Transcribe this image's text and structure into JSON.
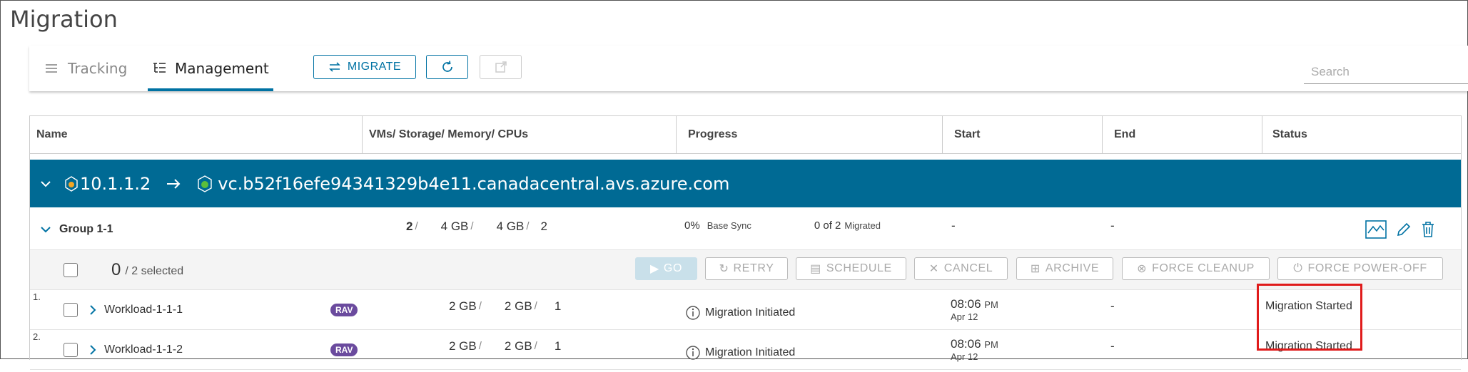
{
  "page": {
    "title": "Migration"
  },
  "tabs": [
    {
      "label": "Tracking",
      "icon": "list-icon",
      "active": false
    },
    {
      "label": "Management",
      "icon": "tree-list-icon",
      "active": true
    }
  ],
  "toolbar": {
    "migrate_label": "MIGRATE",
    "migrate_icon": "swap-arrows-icon",
    "refresh_icon": "refresh-icon",
    "export_icon": "external-link-icon"
  },
  "search": {
    "placeholder": "Search"
  },
  "table": {
    "columns": [
      "Name",
      "VMs/ Storage/ Memory/ CPUs",
      "Progress",
      "Start",
      "End",
      "Status"
    ],
    "site": {
      "source": "10.1.1.2",
      "target": "vc.b52f16efe94341329b4e11.canadacentral.avs.azure.com"
    },
    "group": {
      "name": "Group 1-1",
      "vms": "2",
      "storage": "4 GB",
      "memory": "4 GB",
      "cpus": "2",
      "progress_pct": "0%",
      "progress_label": "Base Sync",
      "migrated_count": "0 of 2",
      "migrated_label": "Migrated",
      "start": "-",
      "end": "-"
    },
    "selection": {
      "count": "0",
      "total": "/ 2 selected"
    },
    "actions": [
      "GO",
      "RETRY",
      "SCHEDULE",
      "CANCEL",
      "ARCHIVE",
      "FORCE CLEANUP",
      "FORCE POWER-OFF"
    ],
    "rows": [
      {
        "index": "1.",
        "name": "Workload-1-1-1",
        "badge": "RAV",
        "storage": "2 GB",
        "memory": "2 GB",
        "cpus": "1",
        "progress": "Migration Initiated",
        "start_time": "08:06",
        "start_ampm": "PM",
        "start_date": "Apr 12",
        "end": "-",
        "status": "Migration Started"
      },
      {
        "index": "2.",
        "name": "Workload-1-1-2",
        "badge": "RAV",
        "storage": "2 GB",
        "memory": "2 GB",
        "cpus": "1",
        "progress": "Migration Initiated",
        "start_time": "08:06",
        "start_ampm": "PM",
        "start_date": "Apr 12",
        "end": "-",
        "status": "Migration Started"
      }
    ]
  },
  "colors": {
    "accent": "#0072a3",
    "site_bar": "#006a94",
    "badge": "#6b4b9e",
    "highlight": "#e01b1b"
  }
}
